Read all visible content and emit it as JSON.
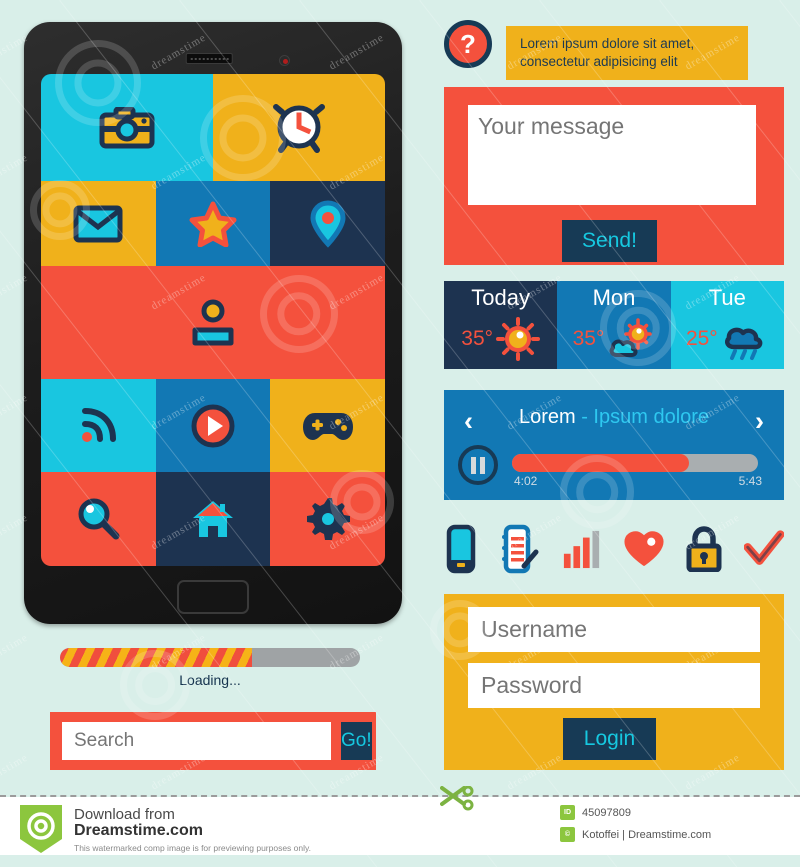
{
  "background_color": "#d9efe9",
  "palette": {
    "red": "#f4513d",
    "yellow": "#f0b11b",
    "cyan": "#19c6e0",
    "blue": "#1278b4",
    "navy": "#173a55",
    "dark_navy": "#1d3350",
    "white": "#ffffff",
    "grey": "#9fa3a5"
  },
  "tablet": {
    "name": "tablet-device",
    "screen_tiles": [
      [
        {
          "icon": "camera-icon",
          "bg": "#19c6e0",
          "flex": 1
        },
        {
          "icon": "alarm-clock-icon",
          "bg": "#f0b11b",
          "flex": 1
        }
      ],
      [
        {
          "icon": "envelope-icon",
          "bg": "#f0b11b",
          "flex": 1
        },
        {
          "icon": "star-icon",
          "bg": "#1278b4",
          "flex": 1
        },
        {
          "icon": "location-pin-icon",
          "bg": "#1d3350",
          "flex": 1
        }
      ],
      [
        {
          "icon": "user-icon",
          "bg": "#f4513d",
          "flex": 1
        }
      ],
      [
        {
          "icon": "rss-icon",
          "bg": "#19c6e0",
          "flex": 1
        },
        {
          "icon": "play-icon",
          "bg": "#1278b4",
          "flex": 1
        },
        {
          "icon": "gamepad-icon",
          "bg": "#f0b11b",
          "flex": 1
        }
      ],
      [
        {
          "icon": "magnifier-icon",
          "bg": "#f4513d",
          "flex": 1
        },
        {
          "icon": "home-icon",
          "bg": "#1d3350",
          "flex": 1
        },
        {
          "icon": "gear-icon",
          "bg": "#f4513d",
          "flex": 1
        }
      ]
    ]
  },
  "loading": {
    "label": "Loading...",
    "progress_percent": 64
  },
  "search": {
    "placeholder": "Search",
    "value": "",
    "go_label": "Go!"
  },
  "tooltip": {
    "badge_glyph": "?",
    "text": "Lorem ipsum dolore sit amet, consectetur adipisicing elit"
  },
  "message": {
    "placeholder": "Your message",
    "value": "",
    "send_label": "Send!"
  },
  "weather": {
    "days": [
      {
        "day": "Today",
        "temp": "35°",
        "icon": "sun-icon",
        "bg": "#1d3350"
      },
      {
        "day": "Mon",
        "temp": "35°",
        "icon": "sun-cloud-icon",
        "bg": "#1278b4"
      },
      {
        "day": "Tue",
        "temp": "25°",
        "icon": "rain-cloud-icon",
        "bg": "#19c6e0"
      }
    ]
  },
  "player": {
    "title_primary": "Lorem",
    "title_secondary": " - Ipsum dolore",
    "prev_glyph": "‹",
    "next_glyph": "›",
    "time_current": "4:02",
    "time_total": "5:43",
    "progress_percent": 72
  },
  "icon_row": [
    {
      "name": "mobile-phone-icon"
    },
    {
      "name": "notepad-pencil-icon"
    },
    {
      "name": "signal-bars-icon"
    },
    {
      "name": "heart-icon"
    },
    {
      "name": "lock-icon"
    },
    {
      "name": "checkmark-icon"
    }
  ],
  "login": {
    "username_placeholder": "Username",
    "username_value": "",
    "password_placeholder": "Password",
    "password_value": "",
    "login_label": "Login"
  },
  "footer": {
    "download_from": "Download from",
    "domain": "Dreamstime.com",
    "note": "This watermarked comp image is for previewing purposes only.",
    "id_chip": "ID",
    "id_value": "45097809",
    "author_chip": "©",
    "author_value": "Kotoffei | Dreamstime.com"
  },
  "watermark": {
    "text": "dreamstime"
  }
}
